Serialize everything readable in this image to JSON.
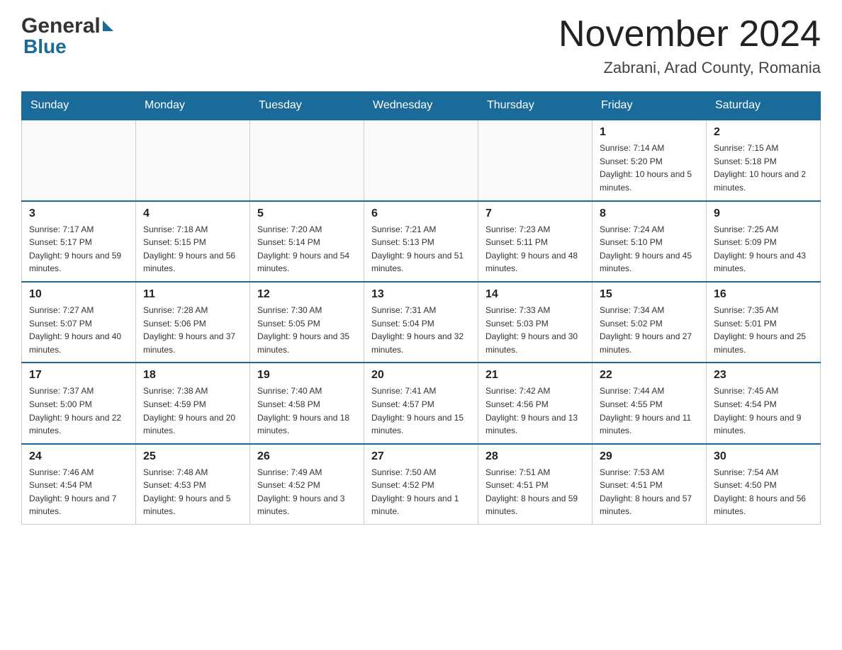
{
  "header": {
    "title": "November 2024",
    "subtitle": "Zabrani, Arad County, Romania"
  },
  "logo": {
    "general": "General",
    "blue": "Blue"
  },
  "days_of_week": [
    "Sunday",
    "Monday",
    "Tuesday",
    "Wednesday",
    "Thursday",
    "Friday",
    "Saturday"
  ],
  "weeks": [
    [
      {
        "day": "",
        "info": ""
      },
      {
        "day": "",
        "info": ""
      },
      {
        "day": "",
        "info": ""
      },
      {
        "day": "",
        "info": ""
      },
      {
        "day": "",
        "info": ""
      },
      {
        "day": "1",
        "info": "Sunrise: 7:14 AM\nSunset: 5:20 PM\nDaylight: 10 hours and 5 minutes."
      },
      {
        "day": "2",
        "info": "Sunrise: 7:15 AM\nSunset: 5:18 PM\nDaylight: 10 hours and 2 minutes."
      }
    ],
    [
      {
        "day": "3",
        "info": "Sunrise: 7:17 AM\nSunset: 5:17 PM\nDaylight: 9 hours and 59 minutes."
      },
      {
        "day": "4",
        "info": "Sunrise: 7:18 AM\nSunset: 5:15 PM\nDaylight: 9 hours and 56 minutes."
      },
      {
        "day": "5",
        "info": "Sunrise: 7:20 AM\nSunset: 5:14 PM\nDaylight: 9 hours and 54 minutes."
      },
      {
        "day": "6",
        "info": "Sunrise: 7:21 AM\nSunset: 5:13 PM\nDaylight: 9 hours and 51 minutes."
      },
      {
        "day": "7",
        "info": "Sunrise: 7:23 AM\nSunset: 5:11 PM\nDaylight: 9 hours and 48 minutes."
      },
      {
        "day": "8",
        "info": "Sunrise: 7:24 AM\nSunset: 5:10 PM\nDaylight: 9 hours and 45 minutes."
      },
      {
        "day": "9",
        "info": "Sunrise: 7:25 AM\nSunset: 5:09 PM\nDaylight: 9 hours and 43 minutes."
      }
    ],
    [
      {
        "day": "10",
        "info": "Sunrise: 7:27 AM\nSunset: 5:07 PM\nDaylight: 9 hours and 40 minutes."
      },
      {
        "day": "11",
        "info": "Sunrise: 7:28 AM\nSunset: 5:06 PM\nDaylight: 9 hours and 37 minutes."
      },
      {
        "day": "12",
        "info": "Sunrise: 7:30 AM\nSunset: 5:05 PM\nDaylight: 9 hours and 35 minutes."
      },
      {
        "day": "13",
        "info": "Sunrise: 7:31 AM\nSunset: 5:04 PM\nDaylight: 9 hours and 32 minutes."
      },
      {
        "day": "14",
        "info": "Sunrise: 7:33 AM\nSunset: 5:03 PM\nDaylight: 9 hours and 30 minutes."
      },
      {
        "day": "15",
        "info": "Sunrise: 7:34 AM\nSunset: 5:02 PM\nDaylight: 9 hours and 27 minutes."
      },
      {
        "day": "16",
        "info": "Sunrise: 7:35 AM\nSunset: 5:01 PM\nDaylight: 9 hours and 25 minutes."
      }
    ],
    [
      {
        "day": "17",
        "info": "Sunrise: 7:37 AM\nSunset: 5:00 PM\nDaylight: 9 hours and 22 minutes."
      },
      {
        "day": "18",
        "info": "Sunrise: 7:38 AM\nSunset: 4:59 PM\nDaylight: 9 hours and 20 minutes."
      },
      {
        "day": "19",
        "info": "Sunrise: 7:40 AM\nSunset: 4:58 PM\nDaylight: 9 hours and 18 minutes."
      },
      {
        "day": "20",
        "info": "Sunrise: 7:41 AM\nSunset: 4:57 PM\nDaylight: 9 hours and 15 minutes."
      },
      {
        "day": "21",
        "info": "Sunrise: 7:42 AM\nSunset: 4:56 PM\nDaylight: 9 hours and 13 minutes."
      },
      {
        "day": "22",
        "info": "Sunrise: 7:44 AM\nSunset: 4:55 PM\nDaylight: 9 hours and 11 minutes."
      },
      {
        "day": "23",
        "info": "Sunrise: 7:45 AM\nSunset: 4:54 PM\nDaylight: 9 hours and 9 minutes."
      }
    ],
    [
      {
        "day": "24",
        "info": "Sunrise: 7:46 AM\nSunset: 4:54 PM\nDaylight: 9 hours and 7 minutes."
      },
      {
        "day": "25",
        "info": "Sunrise: 7:48 AM\nSunset: 4:53 PM\nDaylight: 9 hours and 5 minutes."
      },
      {
        "day": "26",
        "info": "Sunrise: 7:49 AM\nSunset: 4:52 PM\nDaylight: 9 hours and 3 minutes."
      },
      {
        "day": "27",
        "info": "Sunrise: 7:50 AM\nSunset: 4:52 PM\nDaylight: 9 hours and 1 minute."
      },
      {
        "day": "28",
        "info": "Sunrise: 7:51 AM\nSunset: 4:51 PM\nDaylight: 8 hours and 59 minutes."
      },
      {
        "day": "29",
        "info": "Sunrise: 7:53 AM\nSunset: 4:51 PM\nDaylight: 8 hours and 57 minutes."
      },
      {
        "day": "30",
        "info": "Sunrise: 7:54 AM\nSunset: 4:50 PM\nDaylight: 8 hours and 56 minutes."
      }
    ]
  ]
}
